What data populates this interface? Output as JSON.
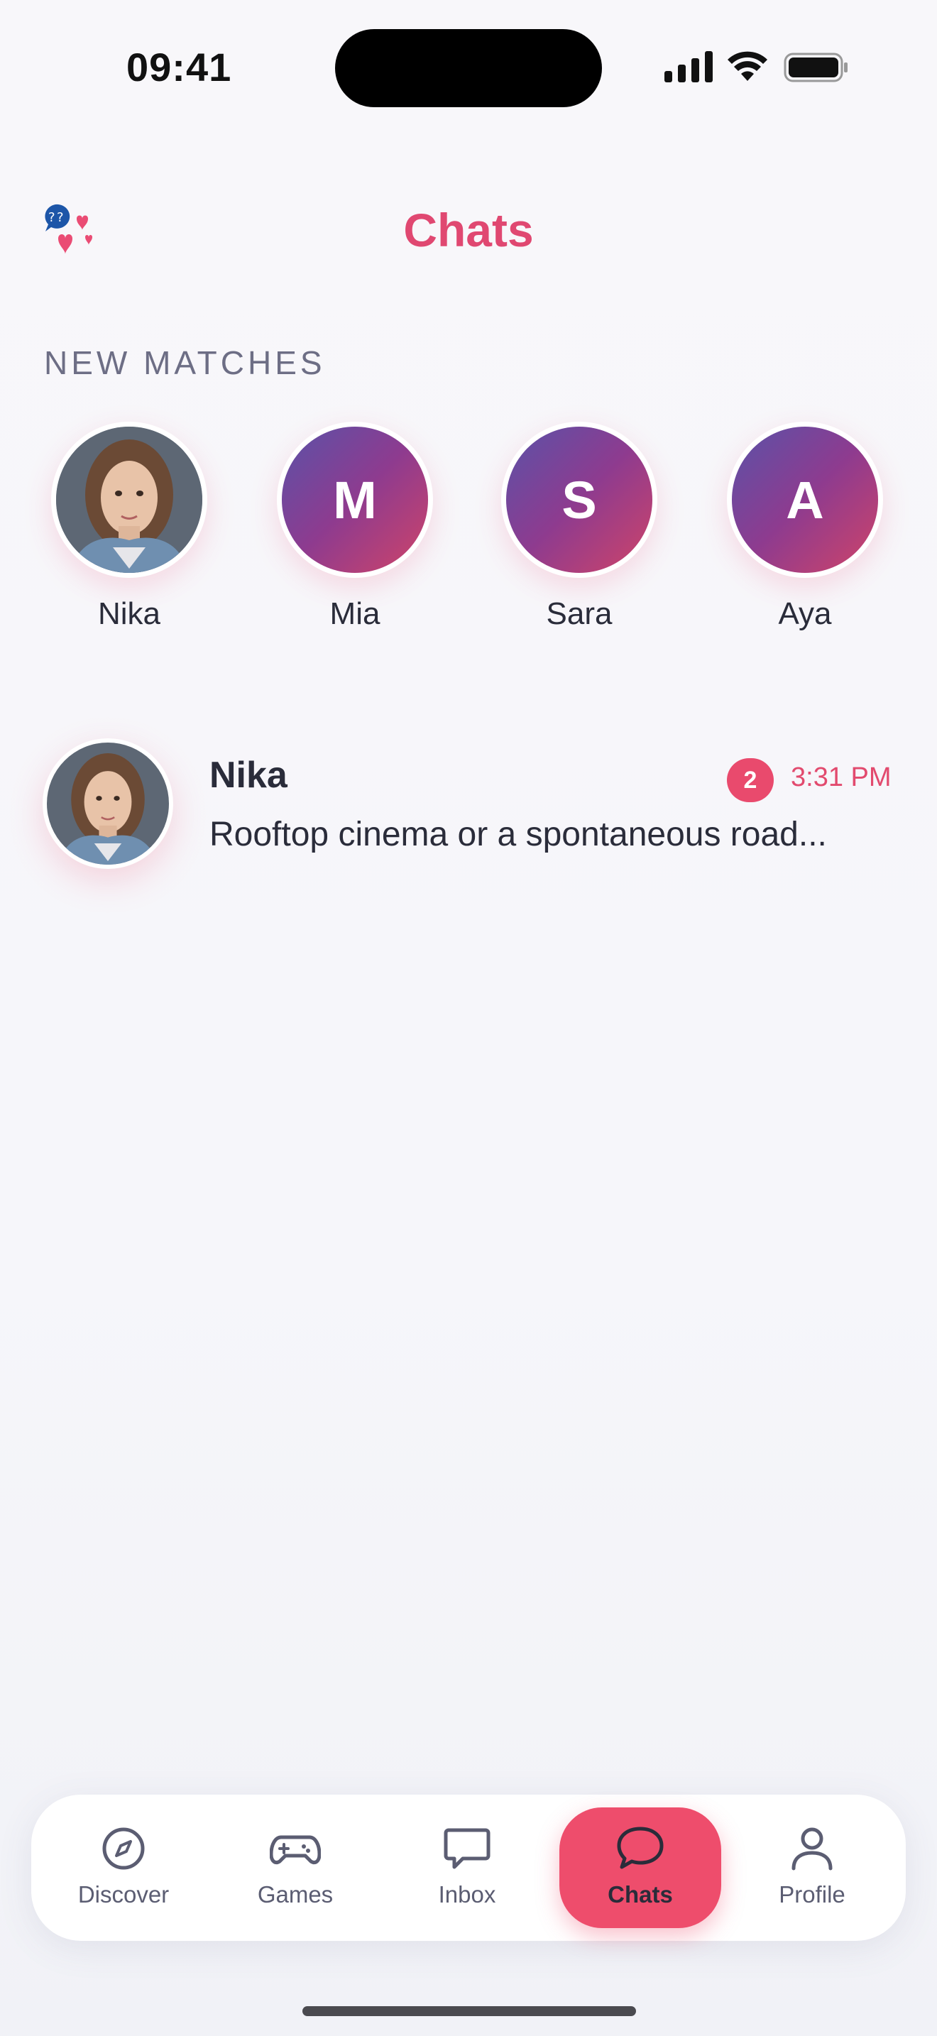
{
  "status_bar": {
    "time": "09:41"
  },
  "header": {
    "title": "Chats",
    "logo_icon": "chat-hearts-logo-icon"
  },
  "new_matches": {
    "label": "NEW MATCHES",
    "items": [
      {
        "name": "Nika",
        "initial": "",
        "has_photo": true
      },
      {
        "name": "Mia",
        "initial": "M",
        "has_photo": false
      },
      {
        "name": "Sara",
        "initial": "S",
        "has_photo": false
      },
      {
        "name": "Aya",
        "initial": "A",
        "has_photo": false
      }
    ]
  },
  "chats": [
    {
      "name": "Nika",
      "preview": "Rooftop cinema or a spontaneous road...",
      "unread": "2",
      "time": "3:31 PM"
    }
  ],
  "tabbar": {
    "items": [
      {
        "label": "Discover",
        "icon": "compass-icon"
      },
      {
        "label": "Games",
        "icon": "gamepad-icon"
      },
      {
        "label": "Inbox",
        "icon": "message-square-icon"
      },
      {
        "label": "Chats",
        "icon": "chat-bubble-icon",
        "active": true
      },
      {
        "label": "Profile",
        "icon": "user-icon"
      }
    ]
  },
  "colors": {
    "accent": "#e04871",
    "badge": "#e94a6d",
    "active_tab": "#ee4d6c",
    "avatar_gradient_start": "#5a52a8",
    "avatar_gradient_end": "#d04468"
  }
}
